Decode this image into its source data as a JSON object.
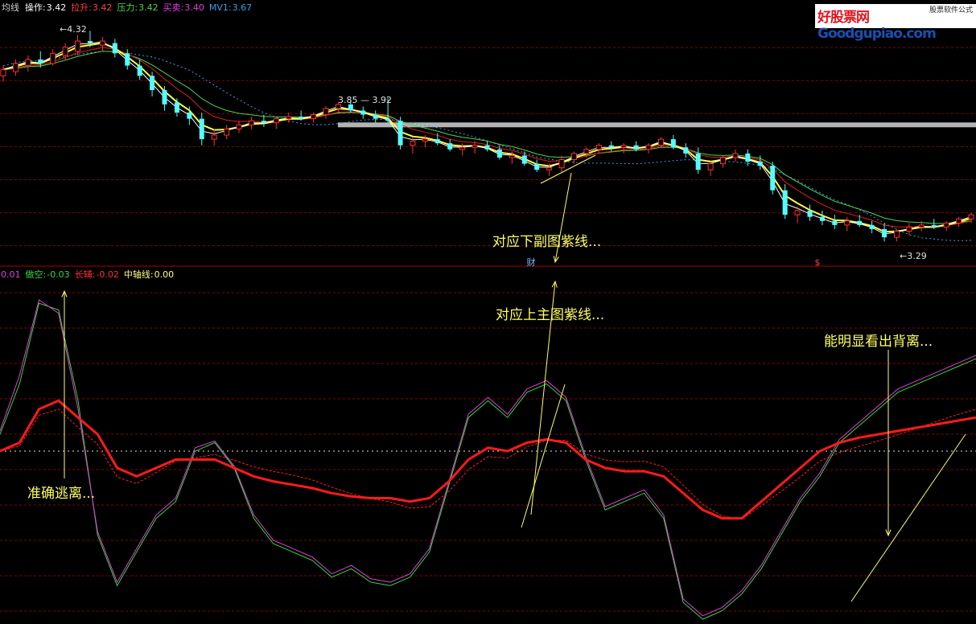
{
  "colors": {
    "background": "#000000",
    "grid": "#8a0000",
    "divider": "#b00000",
    "up": "#ff3232",
    "down": "#54fcfc",
    "ma_white": "#ffffff",
    "ma_yellow": "#ffff3c",
    "ma_green": "#4cd64c",
    "ma_red": "#e01e1e",
    "ma_blue_dotted": "#3aa0e8",
    "resistance_band": "#b4b4b4",
    "osc_green": "#38d838",
    "osc_magenta": "#e040e0",
    "osc_red": "#ff1a1a",
    "annotation": "#ffff64"
  },
  "logo": {
    "brand_text": "好股票网",
    "brand_domain": "Goodgupiao.com",
    "sub_text": "股票软件公式"
  },
  "top_header": {
    "items": [
      {
        "label": "均线",
        "value": "",
        "color": "#d0d0d0"
      },
      {
        "label": "操作:",
        "value": "3.42",
        "color": "#ffffff"
      },
      {
        "label": "拉升:",
        "value": "3.42",
        "color": "#ff4040"
      },
      {
        "label": "压力:",
        "value": "3.42",
        "color": "#4cd64c"
      },
      {
        "label": "买卖:",
        "value": "3.40",
        "color": "#e040e0"
      },
      {
        "label": "MV1:",
        "value": "3.67",
        "color": "#3aa0e8"
      }
    ]
  },
  "bottom_header": {
    "items": [
      {
        "label": "",
        "value": "0.01",
        "color": "#e040e0"
      },
      {
        "label": "做空:",
        "value": "-0.03",
        "color": "#38d838"
      },
      {
        "label": "长辅:",
        "value": "-0.02",
        "color": "#ff3030"
      },
      {
        "label": "中轴线:",
        "value": "0.00",
        "color": "#ffff80"
      }
    ]
  },
  "annotations": {
    "top_main": "对应下副图紫线...",
    "bottom_mid": "对应上主图紫线...",
    "right": "能明显看出背离...",
    "left": "准确逃离...",
    "marker_cai": "财",
    "marker_s": "$",
    "price_high": "4.32",
    "price_low": "3.29",
    "band_price_left": "3.85",
    "band_price_right": "3.92"
  },
  "chart_data": [
    {
      "type": "candlestick",
      "name": "main",
      "y_range": [
        3.22,
        4.4
      ],
      "high_label": 4.32,
      "low_label": 3.29,
      "resistance_band": {
        "value": 3.86,
        "from_price_labels": [
          3.85,
          3.92
        ]
      },
      "ohlc": [
        [
          4.1,
          4.15,
          4.07,
          4.13
        ],
        [
          4.12,
          4.18,
          4.1,
          4.16
        ],
        [
          4.15,
          4.2,
          4.12,
          4.18
        ],
        [
          4.18,
          4.22,
          4.14,
          4.16
        ],
        [
          4.16,
          4.23,
          4.15,
          4.21
        ],
        [
          4.2,
          4.26,
          4.18,
          4.24
        ],
        [
          4.22,
          4.3,
          4.2,
          4.27
        ],
        [
          4.27,
          4.32,
          4.24,
          4.26
        ],
        [
          4.25,
          4.29,
          4.22,
          4.27
        ],
        [
          4.26,
          4.28,
          4.19,
          4.21
        ],
        [
          4.21,
          4.23,
          4.13,
          4.15
        ],
        [
          4.15,
          4.18,
          4.08,
          4.1
        ],
        [
          4.1,
          4.12,
          4.0,
          4.03
        ],
        [
          4.03,
          4.05,
          3.93,
          3.96
        ],
        [
          3.97,
          3.99,
          3.9,
          3.92
        ],
        [
          3.92,
          3.95,
          3.86,
          3.89
        ],
        [
          3.89,
          3.92,
          3.76,
          3.79
        ],
        [
          3.79,
          3.84,
          3.76,
          3.81
        ],
        [
          3.81,
          3.86,
          3.79,
          3.84
        ],
        [
          3.84,
          3.88,
          3.82,
          3.86
        ],
        [
          3.86,
          3.9,
          3.84,
          3.88
        ],
        [
          3.88,
          3.91,
          3.85,
          3.87
        ],
        [
          3.87,
          3.9,
          3.84,
          3.89
        ],
        [
          3.89,
          3.92,
          3.87,
          3.9
        ],
        [
          3.9,
          3.93,
          3.88,
          3.89
        ],
        [
          3.89,
          3.92,
          3.87,
          3.91
        ],
        [
          3.91,
          3.95,
          3.89,
          3.94
        ],
        [
          3.94,
          3.97,
          3.92,
          3.96
        ],
        [
          3.96,
          3.98,
          3.92,
          3.93
        ],
        [
          3.93,
          3.95,
          3.89,
          3.91
        ],
        [
          3.91,
          3.93,
          3.87,
          3.89
        ],
        [
          3.89,
          3.99,
          3.86,
          3.88
        ],
        [
          3.88,
          3.9,
          3.74,
          3.76
        ],
        [
          3.76,
          3.8,
          3.72,
          3.78
        ],
        [
          3.78,
          3.81,
          3.75,
          3.79
        ],
        [
          3.79,
          3.82,
          3.76,
          3.77
        ],
        [
          3.77,
          3.79,
          3.73,
          3.74
        ],
        [
          3.74,
          3.77,
          3.71,
          3.75
        ],
        [
          3.75,
          3.78,
          3.72,
          3.76
        ],
        [
          3.76,
          3.78,
          3.73,
          3.74
        ],
        [
          3.74,
          3.76,
          3.69,
          3.7
        ],
        [
          3.7,
          3.73,
          3.67,
          3.71
        ],
        [
          3.71,
          3.73,
          3.66,
          3.67
        ],
        [
          3.67,
          3.69,
          3.63,
          3.64
        ],
        [
          3.64,
          3.67,
          3.61,
          3.65
        ],
        [
          3.65,
          3.71,
          3.63,
          3.69
        ],
        [
          3.69,
          3.73,
          3.67,
          3.72
        ],
        [
          3.72,
          3.75,
          3.7,
          3.74
        ],
        [
          3.74,
          3.77,
          3.72,
          3.76
        ],
        [
          3.76,
          3.78,
          3.73,
          3.75
        ],
        [
          3.75,
          3.77,
          3.72,
          3.76
        ],
        [
          3.76,
          3.78,
          3.73,
          3.74
        ],
        [
          3.74,
          3.77,
          3.72,
          3.76
        ],
        [
          3.76,
          3.8,
          3.75,
          3.79
        ],
        [
          3.79,
          3.81,
          3.74,
          3.75
        ],
        [
          3.75,
          3.77,
          3.7,
          3.72
        ],
        [
          3.72,
          3.75,
          3.62,
          3.64
        ],
        [
          3.64,
          3.68,
          3.61,
          3.67
        ],
        [
          3.67,
          3.71,
          3.65,
          3.7
        ],
        [
          3.7,
          3.74,
          3.68,
          3.72
        ],
        [
          3.72,
          3.74,
          3.66,
          3.68
        ],
        [
          3.68,
          3.71,
          3.64,
          3.66
        ],
        [
          3.66,
          3.68,
          3.52,
          3.54
        ],
        [
          3.54,
          3.57,
          3.4,
          3.42
        ],
        [
          3.42,
          3.46,
          3.38,
          3.44
        ],
        [
          3.44,
          3.47,
          3.39,
          3.41
        ],
        [
          3.41,
          3.44,
          3.37,
          3.39
        ],
        [
          3.39,
          3.42,
          3.35,
          3.37
        ],
        [
          3.37,
          3.41,
          3.34,
          3.39
        ],
        [
          3.39,
          3.42,
          3.36,
          3.37
        ],
        [
          3.37,
          3.39,
          3.33,
          3.35
        ],
        [
          3.35,
          3.38,
          3.29,
          3.31
        ],
        [
          3.31,
          3.35,
          3.29,
          3.34
        ],
        [
          3.34,
          3.38,
          3.32,
          3.36
        ],
        [
          3.36,
          3.39,
          3.34,
          3.37
        ],
        [
          3.37,
          3.4,
          3.35,
          3.36
        ],
        [
          3.36,
          3.39,
          3.34,
          3.38
        ],
        [
          3.38,
          3.41,
          3.36,
          3.4
        ],
        [
          3.4,
          3.43,
          3.38,
          3.42
        ]
      ]
    },
    {
      "type": "line",
      "name": "oscillator",
      "y_range": [
        -1.0,
        1.0
      ],
      "axis_line": 0.0,
      "x": [
        0,
        4,
        8,
        12,
        16,
        20,
        24,
        28,
        32,
        36,
        40,
        44,
        48,
        52,
        56,
        60,
        64,
        68,
        72,
        76,
        80,
        84,
        88,
        92,
        96,
        100,
        104,
        108,
        112,
        116,
        120,
        124,
        128,
        132,
        136,
        140,
        144,
        148,
        152,
        156,
        160,
        164,
        168,
        172,
        176,
        180,
        184,
        188,
        192,
        196,
        200
      ],
      "series": [
        {
          "name": "",
          "color_role": "osc_green",
          "values": [
            0.1,
            0.4,
            0.88,
            0.84,
            0.3,
            -0.5,
            -0.8,
            -0.6,
            -0.4,
            -0.3,
            0.0,
            0.05,
            -0.1,
            -0.4,
            -0.55,
            -0.6,
            -0.65,
            -0.75,
            -0.7,
            -0.78,
            -0.8,
            -0.75,
            -0.6,
            -0.2,
            0.2,
            0.3,
            0.2,
            0.35,
            0.4,
            0.3,
            -0.05,
            -0.35,
            -0.3,
            -0.25,
            -0.4,
            -0.9,
            -1.0,
            -0.95,
            -0.85,
            -0.7,
            -0.5,
            -0.3,
            -0.15,
            0.05,
            0.15,
            0.25,
            0.35,
            0.4,
            0.45,
            0.5,
            0.55
          ]
        },
        {
          "name": "",
          "color_role": "osc_magenta",
          "values": [
            0.12,
            0.45,
            0.9,
            0.82,
            0.25,
            -0.48,
            -0.78,
            -0.58,
            -0.38,
            -0.28,
            0.02,
            0.06,
            -0.09,
            -0.38,
            -0.53,
            -0.58,
            -0.63,
            -0.73,
            -0.68,
            -0.76,
            -0.78,
            -0.73,
            -0.58,
            -0.18,
            0.22,
            0.32,
            0.22,
            0.37,
            0.42,
            0.32,
            -0.03,
            -0.33,
            -0.28,
            -0.23,
            -0.38,
            -0.88,
            -0.98,
            -0.93,
            -0.83,
            -0.68,
            -0.48,
            -0.28,
            -0.13,
            0.07,
            0.17,
            0.27,
            0.37,
            0.42,
            0.47,
            0.52,
            0.57
          ]
        },
        {
          "name": "长辅",
          "color_role": "osc_red",
          "values": [
            0.0,
            0.05,
            0.25,
            0.3,
            0.2,
            0.1,
            -0.1,
            -0.15,
            -0.1,
            -0.05,
            -0.05,
            -0.05,
            -0.1,
            -0.15,
            -0.18,
            -0.2,
            -0.22,
            -0.25,
            -0.27,
            -0.28,
            -0.28,
            -0.3,
            -0.28,
            -0.18,
            -0.05,
            0.02,
            0.0,
            0.05,
            0.07,
            0.05,
            -0.05,
            -0.1,
            -0.12,
            -0.12,
            -0.15,
            -0.25,
            -0.35,
            -0.4,
            -0.4,
            -0.3,
            -0.2,
            -0.1,
            0.0,
            0.05,
            0.08,
            0.1,
            0.12,
            0.14,
            0.16,
            0.18,
            0.2
          ]
        }
      ]
    }
  ]
}
